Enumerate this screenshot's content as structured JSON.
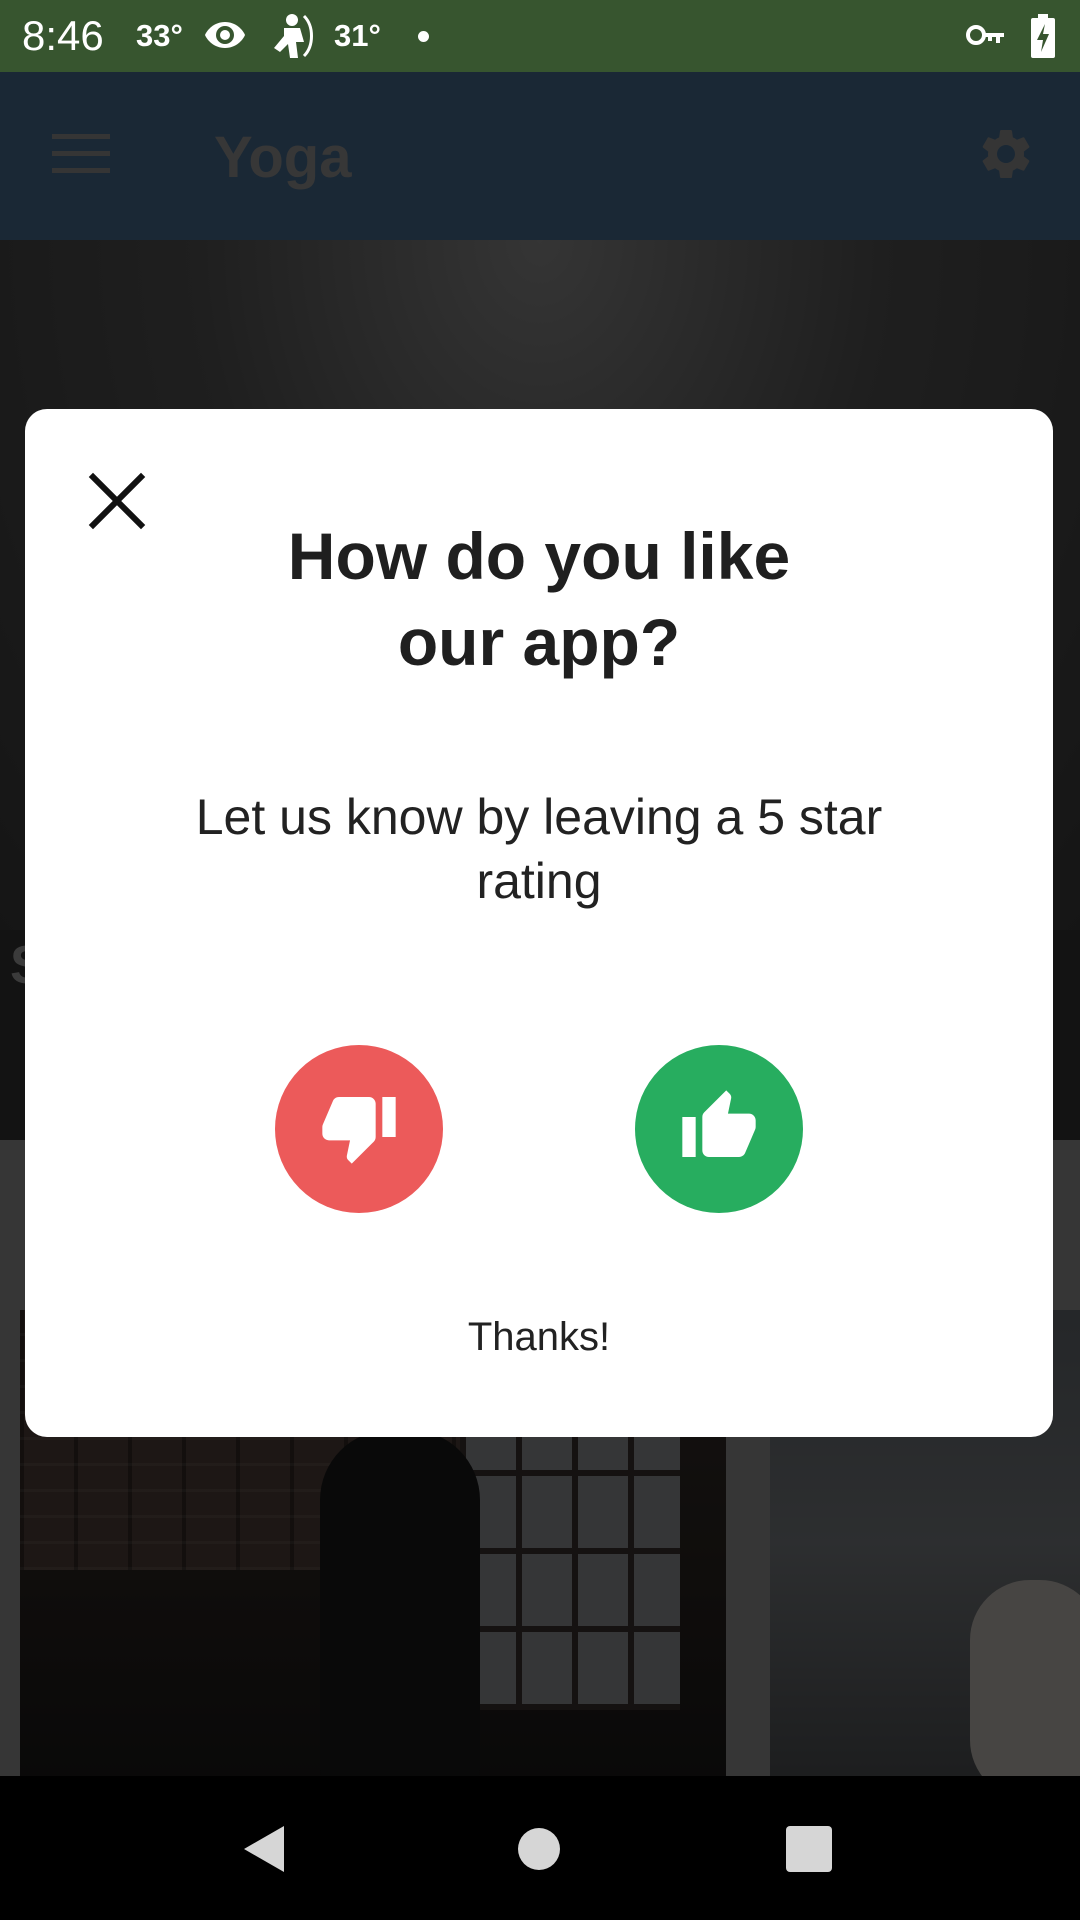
{
  "status_bar": {
    "time": "8:46",
    "temp_1": "33°",
    "temp_2": "31°",
    "icons": [
      "eye-icon",
      "archer-icon",
      "dot-icon",
      "vpn-key-icon",
      "battery-charging-icon"
    ]
  },
  "app_bar": {
    "title": "Yoga",
    "menu_icon": "hamburger-menu-icon",
    "settings_icon": "gear-icon"
  },
  "background": {
    "section_letter": "S"
  },
  "dialog": {
    "close_icon": "close-icon",
    "heading_line_1": "How do you like",
    "heading_line_2": "our app?",
    "message": "Let us know by leaving a 5 star rating",
    "dislike_icon": "thumbs-down-icon",
    "like_icon": "thumbs-up-icon",
    "thanks": "Thanks!",
    "colors": {
      "dislike": "#ec5a5a",
      "like": "#27ad5f"
    }
  },
  "nav_bar": {
    "icons": [
      "back-icon",
      "home-icon",
      "recents-icon"
    ]
  },
  "colors": {
    "status_bar": "#37552f",
    "app_bar": "#34506b"
  }
}
